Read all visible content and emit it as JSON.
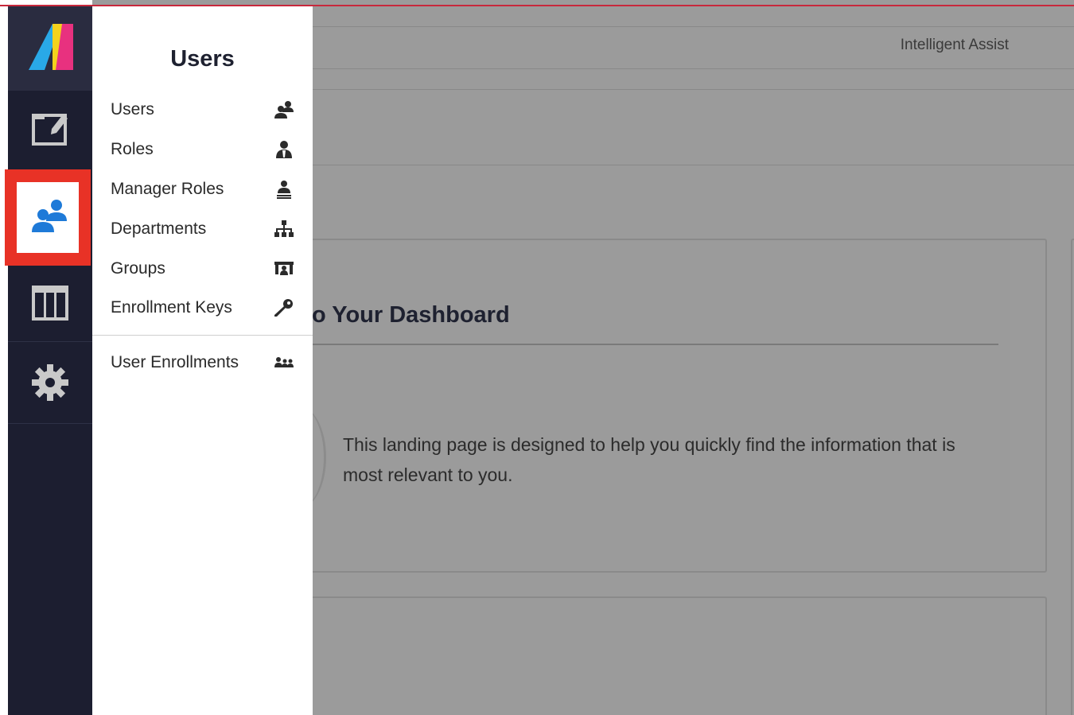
{
  "header": {
    "assist_label": "Intelligent Assist"
  },
  "dashboard": {
    "welcome_title": "o Your Dashboard",
    "welcome_text": "This landing page is designed to help you quickly find the information that is most relevant to you."
  },
  "rail": {
    "items": [
      {
        "name": "editor",
        "icon": "edit-window-icon"
      },
      {
        "name": "users",
        "icon": "users-icon",
        "active": true
      },
      {
        "name": "tables",
        "icon": "table-columns-icon"
      },
      {
        "name": "settings",
        "icon": "gear-icon"
      }
    ]
  },
  "flyout": {
    "title": "Users",
    "items": [
      {
        "label": "Users",
        "icon": "users-icon"
      },
      {
        "label": "Roles",
        "icon": "user-role-icon"
      },
      {
        "label": "Manager Roles",
        "icon": "manager-stamp-icon"
      },
      {
        "label": "Departments",
        "icon": "org-chart-icon"
      },
      {
        "label": "Groups",
        "icon": "groups-icon"
      },
      {
        "label": "Enrollment Keys",
        "icon": "key-icon"
      }
    ],
    "secondary_items": [
      {
        "label": "User Enrollments",
        "icon": "user-enrollments-icon"
      }
    ]
  },
  "colors": {
    "rail_bg": "#1c1e30",
    "highlight": "#e83226",
    "users_icon": "#1e7ad8",
    "accent_red": "#c8283c",
    "logo_blue": "#29a9e8",
    "logo_yellow": "#f4d21c",
    "logo_pink": "#e8317f"
  }
}
